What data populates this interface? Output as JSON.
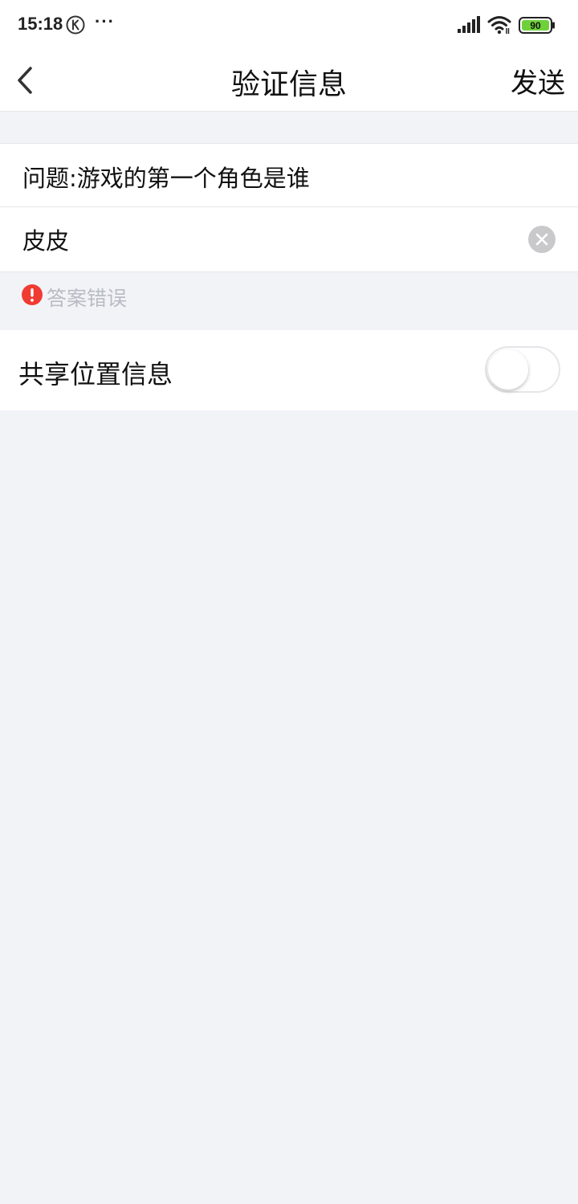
{
  "status_bar": {
    "time": "15:18",
    "more_dots": "···",
    "battery_level": "90",
    "battery_color": "#6ed13a",
    "icons": [
      "k-icon",
      "signal-icon",
      "wifi-icon",
      "battery-icon"
    ]
  },
  "nav": {
    "title": "验证信息",
    "send_label": "发送",
    "back_icon": "chevron-left-icon"
  },
  "form": {
    "question": "问题:游戏的第一个角色是谁",
    "answer_value": "皮皮",
    "clear_icon": "clear-circle-icon",
    "error_icon": "exclamation-circle-icon",
    "error_color": "#f03b33",
    "error_text": "答案错误"
  },
  "location": {
    "label": "共享位置信息",
    "enabled": false
  }
}
